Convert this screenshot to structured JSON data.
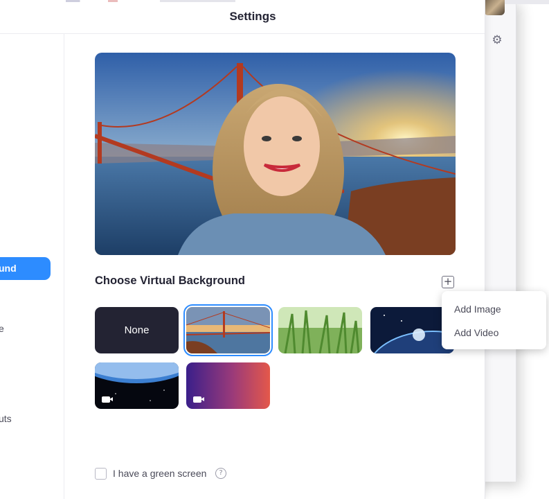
{
  "window": {
    "title": "Settings"
  },
  "sidebar": {
    "items": [
      {
        "label": "und",
        "active": true
      },
      {
        "label": "e",
        "active": false
      },
      {
        "label": "uts",
        "active": false
      }
    ]
  },
  "virtual_background": {
    "section_title": "Choose Virtual Background",
    "thumbnails": [
      {
        "label": "None",
        "kind": "none"
      },
      {
        "label": "",
        "kind": "image",
        "selected": true,
        "subject": "golden gate bridge"
      },
      {
        "label": "",
        "kind": "image",
        "subject": "grass"
      },
      {
        "label": "",
        "kind": "image",
        "subject": "earth from space"
      },
      {
        "label": "",
        "kind": "video",
        "subject": "earth horizon"
      },
      {
        "label": "",
        "kind": "video",
        "subject": "purple gradient"
      }
    ],
    "add_menu": [
      "Add Image",
      "Add Video"
    ],
    "green_screen_label": "I have a green screen",
    "green_screen_checked": false
  },
  "colors": {
    "accent": "#2d8cff",
    "text_dark": "#232333",
    "none_tile": "#232333"
  }
}
